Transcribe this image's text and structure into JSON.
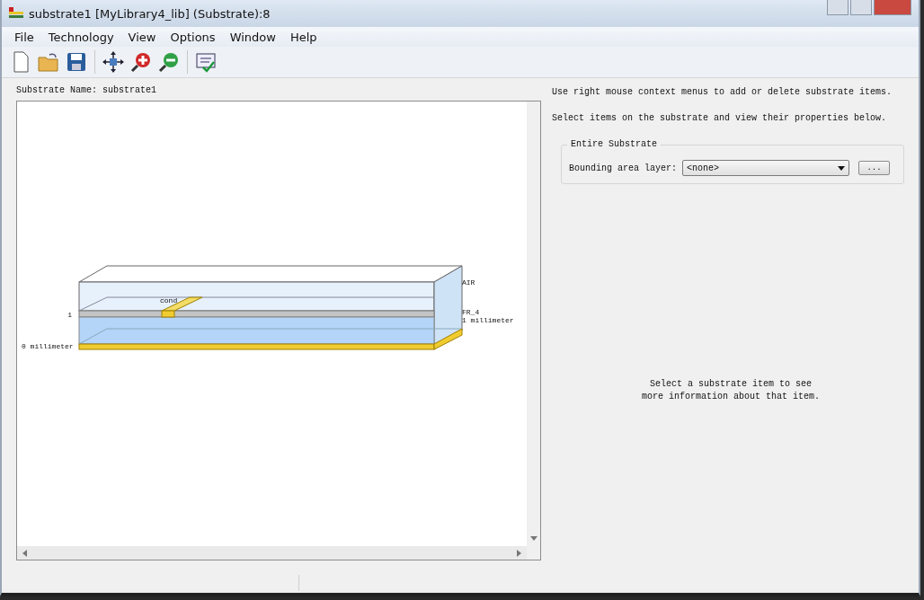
{
  "window": {
    "title": "substrate1 [MyLibrary4_lib] (Substrate):8"
  },
  "menu": [
    "File",
    "Technology",
    "View",
    "Options",
    "Window",
    "Help"
  ],
  "substrate_name": {
    "label": "Substrate Name:",
    "value": "substrate1"
  },
  "canvas": {
    "labels": [
      {
        "kind": "layer",
        "text": "AIR"
      },
      {
        "kind": "layer",
        "text": "FR_4"
      },
      {
        "kind": "height",
        "text": "1 millimeter"
      },
      {
        "kind": "index",
        "text": "1"
      },
      {
        "kind": "height",
        "text": "0 millimeter"
      },
      {
        "kind": "conductor",
        "text": "cond"
      }
    ]
  },
  "hints": [
    "Use right mouse context menus to add or delete substrate items.",
    "Select items on the substrate and view their properties below."
  ],
  "entire_substrate": {
    "title": "Entire Substrate",
    "field_label": "Bounding area layer:",
    "value": "<none>",
    "button": "..."
  },
  "info": [
    "Select a substrate item to see",
    "more information about that item."
  ]
}
